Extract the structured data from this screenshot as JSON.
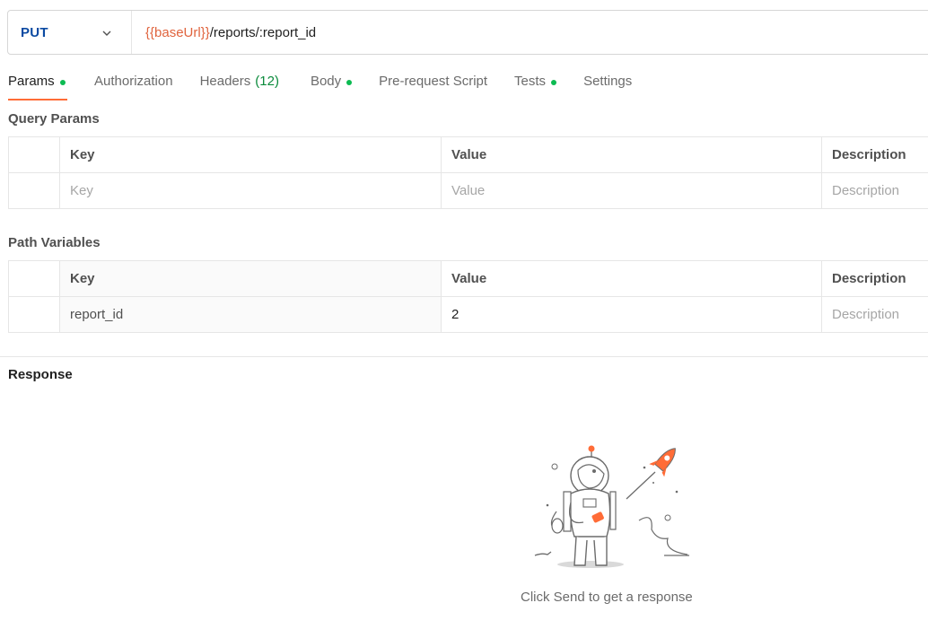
{
  "request": {
    "method": "PUT",
    "url_variable": "{{baseUrl}}",
    "url_path": "/reports/:report_id"
  },
  "tabs": [
    {
      "label": "Params",
      "dot": true,
      "active": true
    },
    {
      "label": "Authorization"
    },
    {
      "label": "Headers",
      "count": "(12)"
    },
    {
      "label": "Body",
      "dot": true
    },
    {
      "label": "Pre-request Script"
    },
    {
      "label": "Tests",
      "dot": true
    },
    {
      "label": "Settings"
    }
  ],
  "query_params": {
    "title": "Query Params",
    "headers": [
      "Key",
      "Value",
      "Description"
    ],
    "placeholders": {
      "key": "Key",
      "value": "Value",
      "description": "Description"
    }
  },
  "path_variables": {
    "title": "Path Variables",
    "headers": [
      "Key",
      "Value",
      "Description"
    ],
    "rows": [
      {
        "key": "report_id",
        "value": "2",
        "description_placeholder": "Description"
      }
    ]
  },
  "response": {
    "title": "Response",
    "empty_message": "Click Send to get a response"
  },
  "colors": {
    "accent": "#ff6c37",
    "method": "#0b4aa2",
    "variable": "#e0643e",
    "dot": "#0cbb52"
  }
}
